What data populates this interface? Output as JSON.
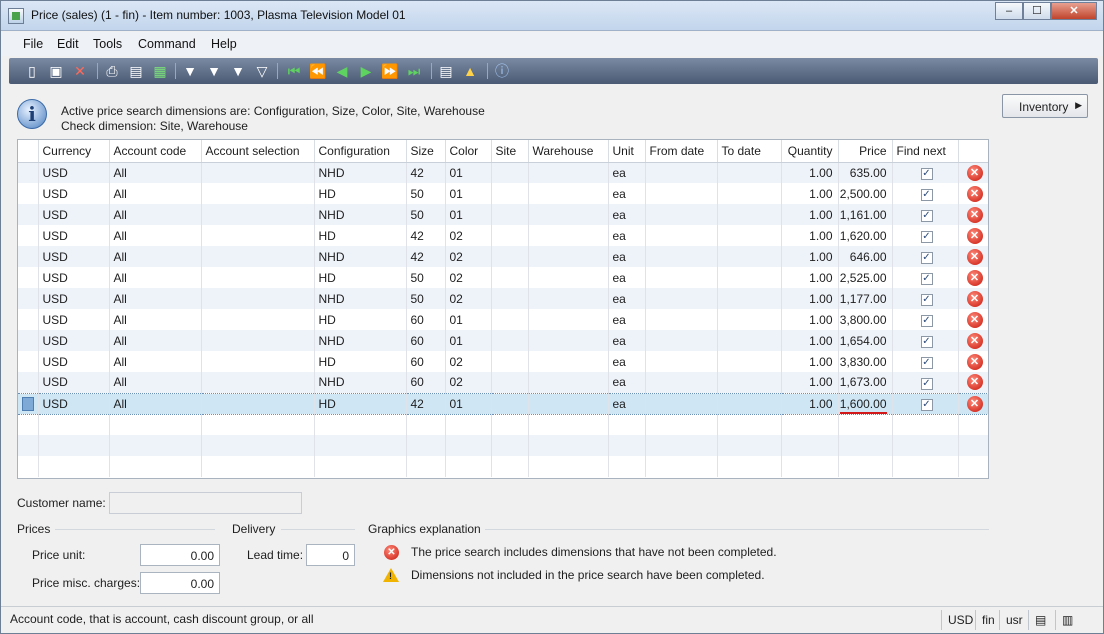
{
  "window": {
    "title": "Price (sales) (1 - fin) - Item number: 1003, Plasma Television Model 01",
    "minimize": "‒",
    "maximize": "☐",
    "close": "✕"
  },
  "menu": [
    "File",
    "Edit",
    "Tools",
    "Command",
    "Help"
  ],
  "info": {
    "line1": "Active price search dimensions are: Configuration, Size, Color, Site, Warehouse",
    "line2": "Check dimension: Site, Warehouse"
  },
  "inventory_button": "Inventory",
  "grid": {
    "columns": [
      "Currency",
      "Account code",
      "Account selection",
      "Configuration",
      "Size",
      "Color",
      "Site",
      "Warehouse",
      "Unit",
      "From date",
      "To date",
      "Quantity",
      "Price",
      "Find next"
    ],
    "rows": [
      {
        "currency": "USD",
        "account_code": "All",
        "account_selection": "",
        "configuration": "NHD",
        "size": "42",
        "color": "01",
        "site": "",
        "warehouse": "",
        "unit": "ea",
        "from_date": "",
        "to_date": "",
        "quantity": "1.00",
        "price": "635.00",
        "find_next": true
      },
      {
        "currency": "USD",
        "account_code": "All",
        "account_selection": "",
        "configuration": "HD",
        "size": "50",
        "color": "01",
        "site": "",
        "warehouse": "",
        "unit": "ea",
        "from_date": "",
        "to_date": "",
        "quantity": "1.00",
        "price": "2,500.00",
        "find_next": true
      },
      {
        "currency": "USD",
        "account_code": "All",
        "account_selection": "",
        "configuration": "NHD",
        "size": "50",
        "color": "01",
        "site": "",
        "warehouse": "",
        "unit": "ea",
        "from_date": "",
        "to_date": "",
        "quantity": "1.00",
        "price": "1,161.00",
        "find_next": true
      },
      {
        "currency": "USD",
        "account_code": "All",
        "account_selection": "",
        "configuration": "HD",
        "size": "42",
        "color": "02",
        "site": "",
        "warehouse": "",
        "unit": "ea",
        "from_date": "",
        "to_date": "",
        "quantity": "1.00",
        "price": "1,620.00",
        "find_next": true
      },
      {
        "currency": "USD",
        "account_code": "All",
        "account_selection": "",
        "configuration": "NHD",
        "size": "42",
        "color": "02",
        "site": "",
        "warehouse": "",
        "unit": "ea",
        "from_date": "",
        "to_date": "",
        "quantity": "1.00",
        "price": "646.00",
        "find_next": true
      },
      {
        "currency": "USD",
        "account_code": "All",
        "account_selection": "",
        "configuration": "HD",
        "size": "50",
        "color": "02",
        "site": "",
        "warehouse": "",
        "unit": "ea",
        "from_date": "",
        "to_date": "",
        "quantity": "1.00",
        "price": "2,525.00",
        "find_next": true
      },
      {
        "currency": "USD",
        "account_code": "All",
        "account_selection": "",
        "configuration": "NHD",
        "size": "50",
        "color": "02",
        "site": "",
        "warehouse": "",
        "unit": "ea",
        "from_date": "",
        "to_date": "",
        "quantity": "1.00",
        "price": "1,177.00",
        "find_next": true
      },
      {
        "currency": "USD",
        "account_code": "All",
        "account_selection": "",
        "configuration": "HD",
        "size": "60",
        "color": "01",
        "site": "",
        "warehouse": "",
        "unit": "ea",
        "from_date": "",
        "to_date": "",
        "quantity": "1.00",
        "price": "3,800.00",
        "find_next": true
      },
      {
        "currency": "USD",
        "account_code": "All",
        "account_selection": "",
        "configuration": "NHD",
        "size": "60",
        "color": "01",
        "site": "",
        "warehouse": "",
        "unit": "ea",
        "from_date": "",
        "to_date": "",
        "quantity": "1.00",
        "price": "1,654.00",
        "find_next": true
      },
      {
        "currency": "USD",
        "account_code": "All",
        "account_selection": "",
        "configuration": "HD",
        "size": "60",
        "color": "02",
        "site": "",
        "warehouse": "",
        "unit": "ea",
        "from_date": "",
        "to_date": "",
        "quantity": "1.00",
        "price": "3,830.00",
        "find_next": true
      },
      {
        "currency": "USD",
        "account_code": "All",
        "account_selection": "",
        "configuration": "NHD",
        "size": "60",
        "color": "02",
        "site": "",
        "warehouse": "",
        "unit": "ea",
        "from_date": "",
        "to_date": "",
        "quantity": "1.00",
        "price": "1,673.00",
        "find_next": true
      },
      {
        "currency": "USD",
        "account_code": "All",
        "account_selection": "",
        "configuration": "HD",
        "size": "42",
        "color": "01",
        "site": "",
        "warehouse": "",
        "unit": "ea",
        "from_date": "",
        "to_date": "",
        "quantity": "1.00",
        "price": "1,600.00",
        "find_next": true
      }
    ],
    "selected_row": 11,
    "checkmark": "✓",
    "error_glyph": "✕"
  },
  "customer": {
    "label": "Customer name:",
    "value": ""
  },
  "prices": {
    "group_label": "Prices",
    "price_unit_label": "Price unit:",
    "price_unit_value": "0.00",
    "misc_label": "Price misc. charges:",
    "misc_value": "0.00"
  },
  "delivery": {
    "group_label": "Delivery",
    "lead_time_label": "Lead time:",
    "lead_time_value": "0"
  },
  "graphics": {
    "group_label": "Graphics explanation",
    "error_text": "The price search includes dimensions that have not been completed.",
    "warning_text": "Dimensions not included in the price search have been completed."
  },
  "status": {
    "text": "Account code, that is account, cash discount group, or all",
    "currency": "USD",
    "company": "fin",
    "layer": "usr"
  },
  "colors": {
    "selected_row": "#cfe6f5",
    "alt_row": "#eef3fa",
    "error_red": "#c8160b",
    "warning_yellow": "#f0b400",
    "toolbar_bg": "#4a5a74"
  }
}
